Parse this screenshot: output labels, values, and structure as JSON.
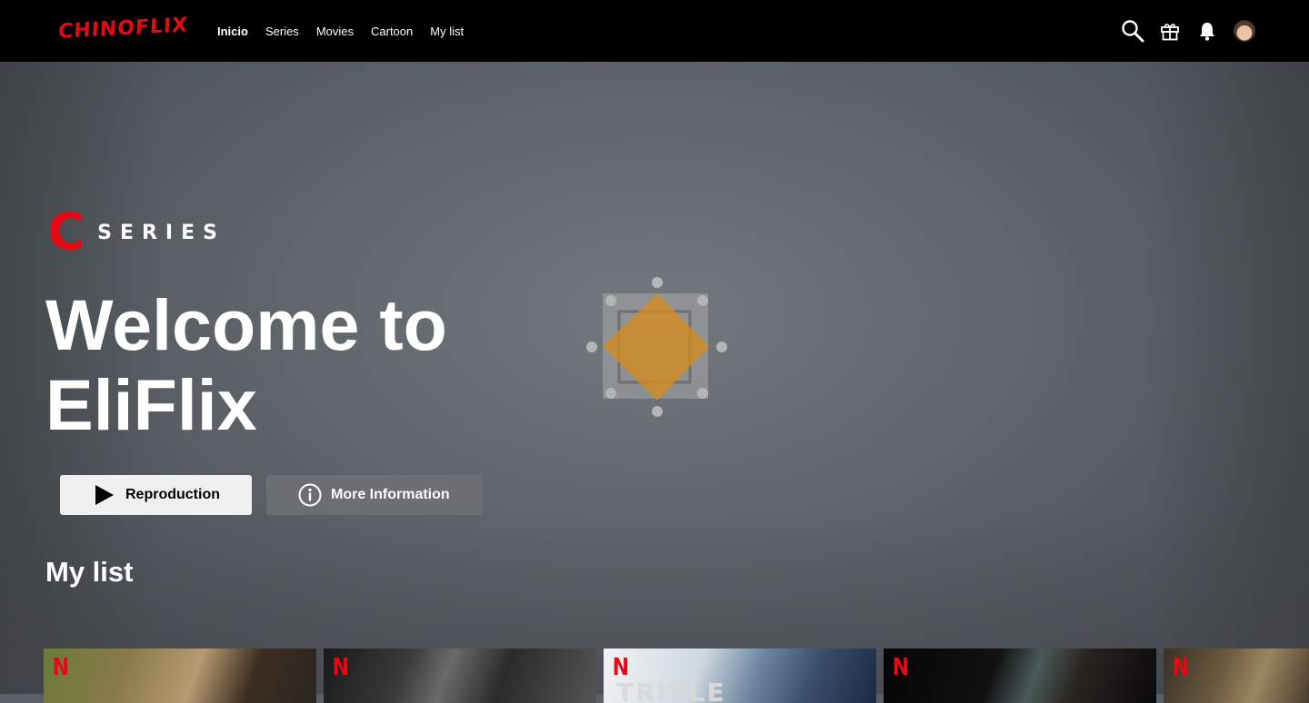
{
  "brand": {
    "logo_text": "CHINOFLIX"
  },
  "nav": {
    "items": [
      {
        "label": "Inicio",
        "active": true
      },
      {
        "label": "Series",
        "active": false
      },
      {
        "label": "Movies",
        "active": false
      },
      {
        "label": "Cartoon",
        "active": false
      },
      {
        "label": "My list",
        "active": false
      }
    ]
  },
  "header_icons": [
    "search-icon",
    "gift-icon",
    "bell-icon",
    "avatar"
  ],
  "hero": {
    "badge_letter": "C",
    "badge_word": "SERIES",
    "title": "Welcome to EliFlix",
    "play_label": "Reproduction",
    "info_label": "More Information"
  },
  "row": {
    "title": "My list",
    "cards": [
      {
        "badge": "N",
        "text": ""
      },
      {
        "badge": "N",
        "text": ""
      },
      {
        "badge": "N",
        "text": "TRIPLE"
      },
      {
        "badge": "N",
        "text": ""
      },
      {
        "badge": "N",
        "text": ""
      }
    ]
  },
  "colors": {
    "brand_red": "#e50914",
    "topbar": "#000000",
    "hero_bg": "#5b6067",
    "play_button": "#f0f0f0",
    "info_button": "#6b6e72"
  }
}
